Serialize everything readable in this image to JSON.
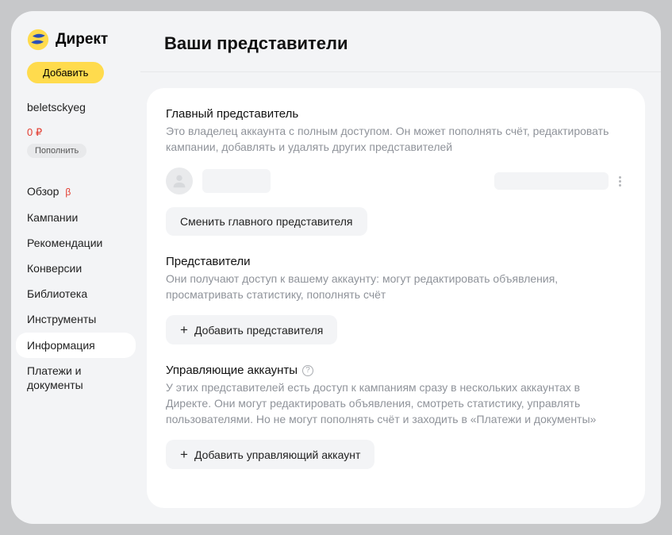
{
  "app": {
    "name": "Директ"
  },
  "sidebar": {
    "add_label": "Добавить",
    "username": "beletsckyeg",
    "balance": "0 ₽",
    "topup_label": "Пополнить",
    "nav": [
      {
        "label": "Обзор",
        "beta": "β"
      },
      {
        "label": "Кампании"
      },
      {
        "label": "Рекомендации"
      },
      {
        "label": "Конверсии"
      },
      {
        "label": "Библиотека"
      },
      {
        "label": "Инструменты"
      },
      {
        "label": "Информация",
        "active": true
      },
      {
        "label": "Платежи и документы"
      }
    ]
  },
  "header": {
    "title": "Ваши представители"
  },
  "sections": {
    "main_rep": {
      "title": "Главный представитель",
      "desc": "Это владелец аккаунта с полным доступом. Он может пополнять счёт, редактировать кампании, добавлять и удалять других представителей",
      "change_btn": "Сменить главного представителя"
    },
    "reps": {
      "title": "Представители",
      "desc": "Они получают доступ к вашему аккаунту: могут редактировать объявления, просматривать статистику, пополнять счёт",
      "add_btn": "Добавить представителя"
    },
    "managing": {
      "title": "Управляющие аккаунты",
      "desc": "У этих представителей есть доступ к кампаниям сразу в нескольких аккаунтах в Директе. Они могут редактировать объявления, смотреть статистику, управлять пользователями. Но не могут пополнять счёт и заходить в «Платежи и документы»",
      "add_btn": "Добавить управляющий аккаунт"
    }
  }
}
